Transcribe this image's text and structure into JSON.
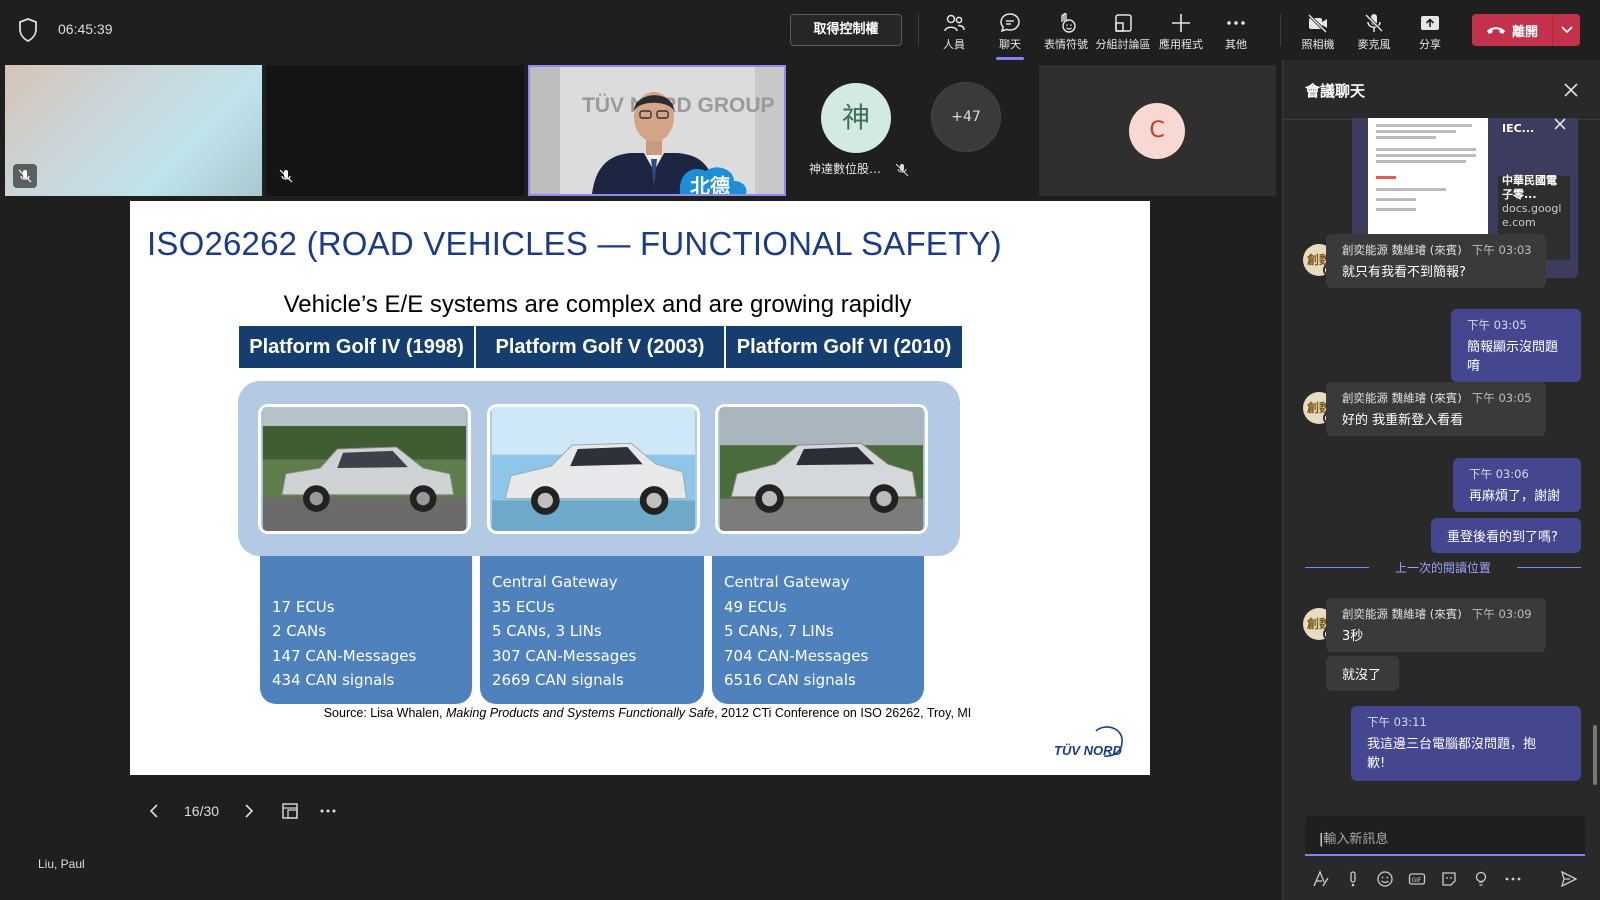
{
  "topbar": {
    "timer": "06:45:39",
    "take_control": "取得控制權",
    "buttons": [
      {
        "label": "人員",
        "icon": "people-icon"
      },
      {
        "label": "聊天",
        "icon": "chat-icon"
      },
      {
        "label": "表情符號",
        "icon": "reactions-icon"
      },
      {
        "label": "分組討論區",
        "icon": "breakout-rooms-icon"
      },
      {
        "label": "應用程式",
        "icon": "add-apps-icon"
      },
      {
        "label": "其他",
        "icon": "more-icon"
      },
      {
        "label": "照相機",
        "icon": "camera-off-icon"
      },
      {
        "label": "麥克風",
        "icon": "mic-off-icon"
      },
      {
        "label": "分享",
        "icon": "share-icon"
      }
    ],
    "leave_label": "離開"
  },
  "participants": {
    "shen_initial": "神",
    "shen_name": "神達數位股…",
    "overflow_count": "+47",
    "c_initial": "C",
    "banner_text": "TÜV NORD GROUP",
    "cloud_text": "北德"
  },
  "slide": {
    "title": "ISO26262 (ROAD VEHICLES — FUNCTIONAL SAFETY)",
    "subtitle": "Vehicle’s E/E systems are complex and are growing rapidly",
    "platforms": [
      "Platform Golf IV (1998)",
      "Platform Golf V (2003)",
      "Platform Golf VI (2010)"
    ],
    "specs": [
      [
        "17 ECUs",
        "2 CANs",
        "147 CAN-Messages",
        "434 CAN signals"
      ],
      [
        "Central Gateway",
        "35 ECUs",
        "5 CANs, 3 LINs",
        "307 CAN-Messages",
        "2669 CAN signals"
      ],
      [
        "Central Gateway",
        "49 ECUs",
        "5 CANs, 7 LINs",
        "704 CAN-Messages",
        "6516 CAN signals"
      ]
    ],
    "source_prefix": "Source: Lisa Whalen, ",
    "source_title": "Making Products and Systems Functionally Safe",
    "source_suffix": ", 2012 CTi Conference on ISO 26262, Troy, MI",
    "logo_text": "TÜV NORD"
  },
  "slide_nav": {
    "page": "16/30"
  },
  "presenter_name": "Liu, Paul",
  "chat": {
    "title": "會議聊天",
    "link_card": {
      "title": "IEC...",
      "subtitle": "中華民國電子零...",
      "domain": "docs.google.com"
    },
    "messages": [
      {
        "sender": "創奕能源 魏維璿 (來賓)",
        "time": "下午 03:03",
        "text": "就只有我看不到簡報?",
        "avatar": "創魏"
      },
      {
        "time": "下午 03:05",
        "text": "簡報顯示沒問題唷"
      },
      {
        "sender": "創奕能源 魏維璿 (來賓)",
        "time": "下午 03:05",
        "text": "好的 我重新登入看看",
        "avatar": "創魏"
      },
      {
        "time": "下午 03:06",
        "text": "再麻煩了，謝謝"
      },
      {
        "text": "重登後看的到了嗎?"
      },
      {
        "sender": "創奕能源 魏維璿 (來賓)",
        "time": "下午 03:09",
        "text": "3秒",
        "avatar": "創魏"
      },
      {
        "text": "就沒了"
      },
      {
        "time": "下午 03:11",
        "text_line1": "我這邊三台電腦都沒問題，抱",
        "text_line2": "歉!"
      }
    ],
    "read_marker": "上一次的閱讀位置",
    "compose_placeholder": "輸入新訊息"
  },
  "colors": {
    "accent": "#7f85f5",
    "leave_red": "#c4314b",
    "slide_title_blue": "#1a3a8c",
    "platform_header": "#153e6e",
    "spec_box": "#4f81bd",
    "car_panel": "#b3c9e4",
    "outgoing_bubble": "#444790"
  }
}
